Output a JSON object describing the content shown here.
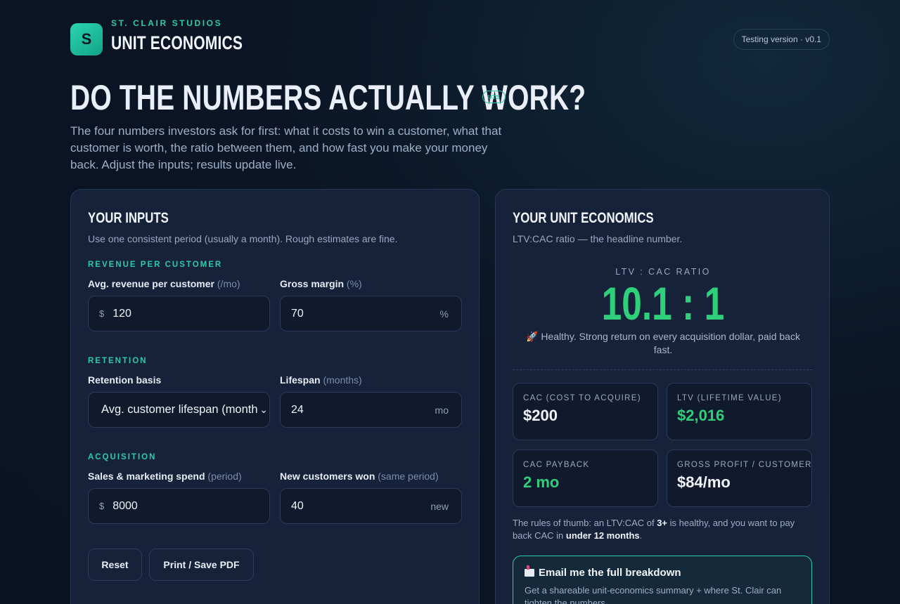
{
  "brand": {
    "logo_letter": "S",
    "kicker": "ST. CLAIR STUDIOS",
    "title": "UNIT ECONOMICS"
  },
  "version_label": "Testing version · v0.1",
  "hero": {
    "title": "DO THE NUMBERS ACTUALLY WORK?",
    "badge": "UTS",
    "description": "The four numbers investors ask for first: what it costs to win a customer, what that customer is worth, the ratio between them, and how fast you make your money back. Adjust the inputs; results update live."
  },
  "inputs": {
    "title": "YOUR INPUTS",
    "subtitle": "Use one consistent period (usually a month). Rough estimates are fine.",
    "revenue_section": "REVENUE PER CUSTOMER",
    "arpc_label": "Avg. revenue per customer",
    "arpc_hint": "(/mo)",
    "arpc_prefix": "$",
    "arpc_value": "120",
    "margin_label": "Gross margin",
    "margin_hint": "(%)",
    "margin_value": "70",
    "margin_suffix": "%",
    "retention_section": "RETENTION",
    "basis_label": "Retention basis",
    "basis_value": "Avg. customer lifespan (months)",
    "lifespan_label": "Lifespan",
    "lifespan_hint": "(months)",
    "lifespan_value": "24",
    "lifespan_suffix": "mo",
    "acquisition_section": "ACQUISITION",
    "spend_label": "Sales & marketing spend",
    "spend_hint": "(period)",
    "spend_prefix": "$",
    "spend_value": "8000",
    "newcust_label": "New customers won",
    "newcust_hint": "(same period)",
    "newcust_value": "40",
    "newcust_suffix": "new",
    "reset_label": "Reset",
    "print_label": "Print / Save PDF"
  },
  "results": {
    "title": "YOUR UNIT ECONOMICS",
    "subtitle": "LTV:CAC ratio — the headline number.",
    "ratio_label": "LTV : CAC RATIO",
    "ratio_value": "10.1 : 1",
    "ratio_note": "🚀 Healthy. Strong return on every acquisition dollar, paid back fast.",
    "metrics": [
      {
        "label": "CAC (COST TO ACQUIRE)",
        "value": "$200"
      },
      {
        "label": "LTV (LIFETIME VALUE)",
        "value": "$2,016"
      },
      {
        "label": "CAC PAYBACK",
        "value": "2 mo"
      },
      {
        "label": "GROSS PROFIT / CUSTOMER",
        "value": "$84/mo"
      }
    ],
    "rules_pre": "The rules of thumb: an LTV:CAC of ",
    "rules_b1": "3+",
    "rules_mid": " is healthy, and you want to pay back CAC in ",
    "rules_b2": "under 12 months",
    "rules_post": ".",
    "email_title": "Email me the full breakdown",
    "email_desc": "Get a shareable unit-economics summary + where St. Clair can tighten the numbers."
  },
  "colors": {
    "accent": "#2ec9a8",
    "positive": "#2fd07a",
    "background": "#0b1525",
    "card": "#16213a"
  }
}
